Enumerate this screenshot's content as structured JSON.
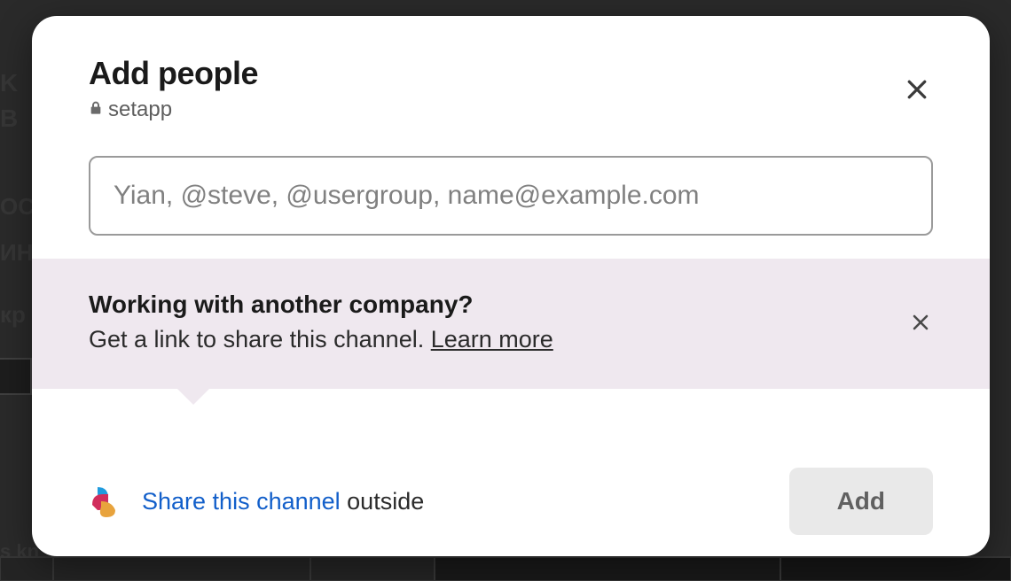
{
  "modal": {
    "title": "Add people",
    "channel_name": "setapp",
    "input_placeholder": "Yian, @steve, @usergroup, name@example.com",
    "input_value": "",
    "banner": {
      "title": "Working with another company?",
      "body_prefix": "Get a link to share this channel. ",
      "learn_more": "Learn more"
    },
    "share": {
      "link_text": "Share this channel",
      "suffix": " outside"
    },
    "add_button": "Add"
  },
  "background_fragments": {
    "a": "K",
    "b": "B",
    "c": "OCT",
    "d": "ИНЬ",
    "e": "кр",
    "f": "s kn"
  }
}
